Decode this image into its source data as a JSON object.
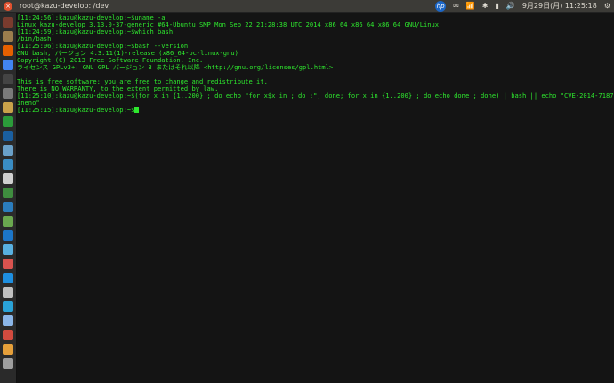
{
  "topbar": {
    "window_title": "root@kazu-develop: /dev",
    "clock": "9月29日(月) 11:25:18"
  },
  "launcher": {
    "icons": [
      "dash-icon",
      "files-icon",
      "firefox-icon",
      "chrome-icon",
      "terminal-icon",
      "settings-icon"
    ]
  },
  "terminal": {
    "lines": [
      "[11:24:56]:kazu@kazu-develop:~$uname -a",
      "Linux kazu-develop 3.13.0-37-generic #64-Ubuntu SMP Mon Sep 22 21:28:38 UTC 2014 x86_64 x86_64 x86_64 GNU/Linux",
      "[11:24:59]:kazu@kazu-develop:~$which bash",
      "/bin/bash",
      "[11:25:06]:kazu@kazu-develop:~$bash --version",
      "GNU bash, バージョン 4.3.11(1)-release (x86_64-pc-linux-gnu)",
      "Copyright (C) 2013 Free Software Foundation, Inc.",
      "ライセンス GPLv3+: GNU GPL バージョン 3 またはそれ以降 <http://gnu.org/licenses/gpl.html>",
      "",
      "This is free software; you are free to change and redistribute it.",
      "There is NO WARRANTY, to the extent permitted by law.",
      "[11:25:10]:kazu@kazu-develop:~$(for x in {1..200} ; do echo \"for x$x in ; do :\"; done; for x in {1..200} ; do echo done ; done) | bash || echo \"CVE-2014-7187 vulnerable, word_l",
      "ineno\"",
      "[11:25:15]:kazu@kazu-develop:~$"
    ]
  }
}
